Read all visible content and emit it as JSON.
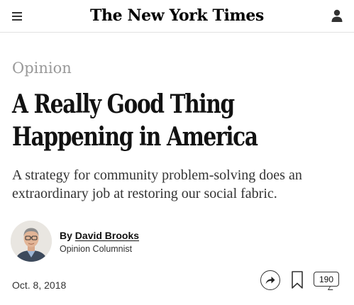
{
  "header": {
    "logo_text": "The New York Times",
    "menu_icon": "hamburger-menu-icon",
    "account_icon": "user-account-icon"
  },
  "article": {
    "kicker": "Opinion",
    "headline_line1": "A Really Good Thing",
    "headline_line2": "Happening in America",
    "summary": "A strategy for community problem-solving does an extraordinary job at restoring our social fabric.",
    "byline": {
      "by": "By",
      "author": "David Brooks",
      "role": "Opinion Columnist"
    },
    "date": "Oct. 8, 2018",
    "actions": {
      "share_icon": "share-icon",
      "bookmark_icon": "bookmark-icon",
      "comments_count": "190"
    }
  },
  "colors": {
    "kicker": "#999999",
    "text": "#121212",
    "divider": "#e2e2e2"
  }
}
